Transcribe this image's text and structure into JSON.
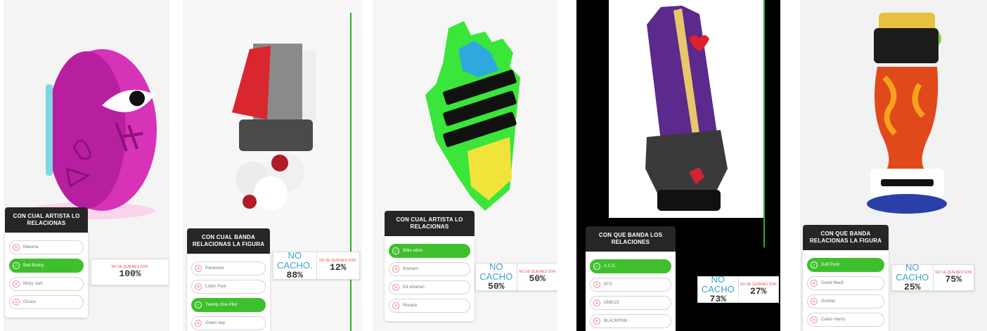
{
  "panels": [
    {
      "question": "CON CUAL ARTISTA LO RELACIONAS",
      "options": [
        {
          "label": "Maluma",
          "selected": false
        },
        {
          "label": "Bad Bunny",
          "selected": true
        },
        {
          "label": "Nicky Jam",
          "selected": false
        },
        {
          "label": "Ozuna",
          "selected": false
        }
      ],
      "slider": {
        "left_label": "",
        "left_percent": "",
        "right_label": "NO SE QUIENES SON.",
        "right_percent": "100%"
      }
    },
    {
      "question": "CON CUAL BANDA RELACIONAS LA FIGURA",
      "options": [
        {
          "label": "Paramore",
          "selected": false
        },
        {
          "label": "Linkin Park",
          "selected": false
        },
        {
          "label": "Twenty One Pilot",
          "selected": true
        },
        {
          "label": "Green day",
          "selected": false
        }
      ],
      "slider": {
        "left_label": "NO CACHO.",
        "left_percent": "88%",
        "right_label": "NO SE QUIENES SON.",
        "right_percent": "12%"
      }
    },
    {
      "question": "CON CUAL ARTISTA LO RELACIONAS",
      "options": [
        {
          "label": "Billie eilish",
          "selected": true
        },
        {
          "label": "Eminem",
          "selected": false
        },
        {
          "label": "Ed sheeran",
          "selected": false
        },
        {
          "label": "Rosalia",
          "selected": false
        }
      ],
      "slider": {
        "left_label": "NO CACHO",
        "left_percent": "50%",
        "right_label": "NO SE QUIENES SON",
        "right_percent": "50%"
      }
    },
    {
      "question": "CON QUE BANDA LOS RELACIONES",
      "options": [
        {
          "label": "A.C.E.",
          "selected": true
        },
        {
          "label": "BTS",
          "selected": false
        },
        {
          "label": "ONEUS",
          "selected": false
        },
        {
          "label": "BLACKPINK",
          "selected": false
        }
      ],
      "slider": {
        "left_label": "NO CACHO",
        "left_percent": "73%",
        "right_label": "NO SE QUIENES SON",
        "right_percent": "27%"
      }
    },
    {
      "question": "CON QUE BANDA RELACIONAS LA FIGURA",
      "options": [
        {
          "label": "Daft Punk",
          "selected": true
        },
        {
          "label": "Gewd Maufi",
          "selected": false
        },
        {
          "label": "Gorillaz",
          "selected": false
        },
        {
          "label": "Calvin Harris",
          "selected": false
        }
      ],
      "slider": {
        "left_label": "NO CACHO",
        "left_percent": "25%",
        "right_label": "NO SE QUIENES SON",
        "right_percent": "75%"
      }
    }
  ],
  "icons": {
    "unchecked": "x-circle-icon",
    "checked": "check-circle-icon"
  },
  "colors": {
    "selected": "#3fbf2d",
    "header": "#262626",
    "cacho": "#3aa4c9",
    "nose": "#e4524f"
  }
}
